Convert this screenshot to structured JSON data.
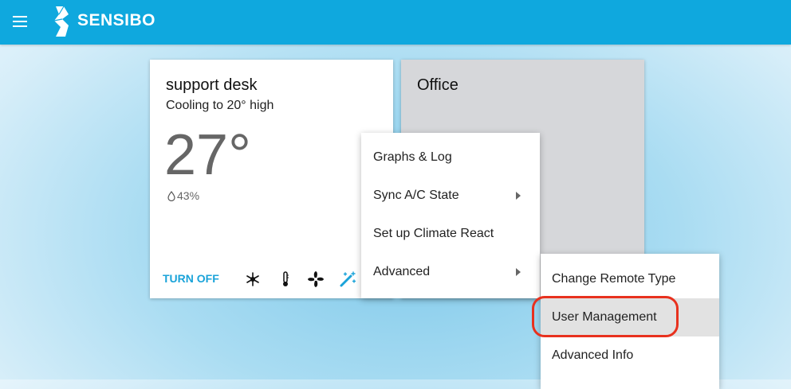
{
  "header": {
    "brand": "SENSIBO",
    "menu_icon": "hamburger-icon",
    "logo_icon": "sensibo-logo-icon",
    "background_color": "#0fa8de"
  },
  "devices": [
    {
      "name": "support desk",
      "status": "Cooling to 20° high",
      "temperature": "27°",
      "humidity": "43%",
      "humidity_icon": "droplet-icon",
      "turn_off_label": "TURN OFF",
      "controls": [
        "snowflake-icon",
        "thermometer-icon",
        "fan-icon",
        "magic-wand-icon"
      ]
    },
    {
      "name": "Office"
    }
  ],
  "context_menu": {
    "items": [
      {
        "label": "Graphs & Log",
        "has_submenu": false
      },
      {
        "label": "Sync A/C State",
        "has_submenu": true
      },
      {
        "label": "Set up Climate React",
        "has_submenu": false
      },
      {
        "label": "Advanced",
        "has_submenu": true
      }
    ]
  },
  "advanced_submenu": {
    "items": [
      {
        "label": "Change Remote Type"
      },
      {
        "label": "User Management",
        "highlighted": true
      },
      {
        "label": "Advanced Info"
      }
    ]
  },
  "colors": {
    "accent": "#1aa3d9",
    "highlight_ring": "#e8311e"
  }
}
